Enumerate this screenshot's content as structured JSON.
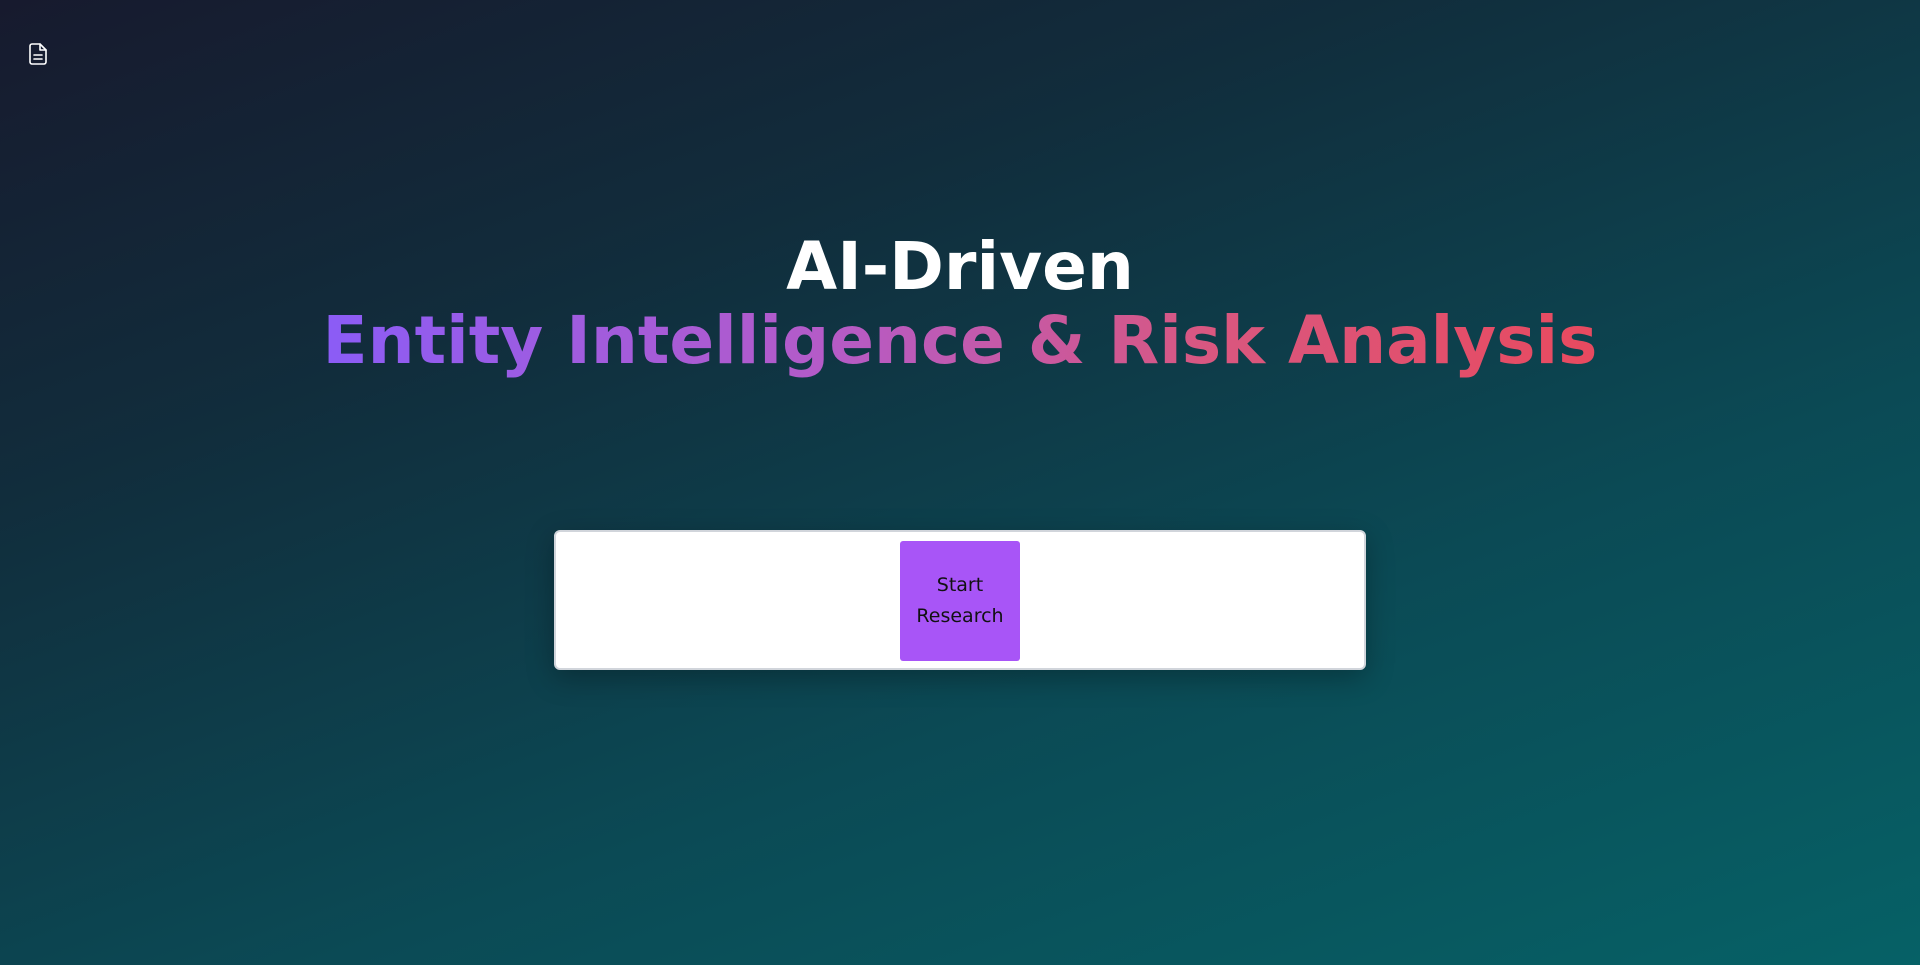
{
  "sidebar_toggle": {
    "icon": "document-icon"
  },
  "hero": {
    "line1": "AI-Driven",
    "line2": "Entity Intelligence & Risk Analysis",
    "gradient_colors": [
      "#8b5cf6",
      "#b55bc7",
      "#d9577f",
      "#e84a5f"
    ]
  },
  "action": {
    "start_label": "Start Research",
    "button_color": "#a855f7"
  },
  "colors": {
    "background_top": "#171a2e",
    "background_bottom": "#066166"
  }
}
